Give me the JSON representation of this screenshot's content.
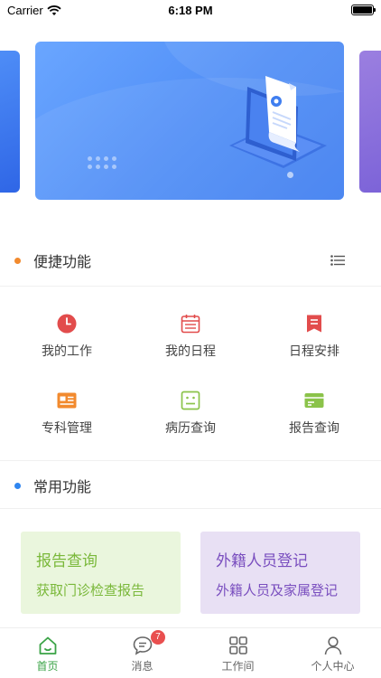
{
  "status_bar": {
    "carrier": "Carrier",
    "time": "6:18 PM"
  },
  "banner": {
    "active_index": 1,
    "icon": "laptop-document-illustration"
  },
  "quick_functions": {
    "title": "便捷功能",
    "accent_color": "#f28a2e",
    "items": [
      {
        "label": "我的工作",
        "icon": "clock-icon",
        "color": "#e24c4c"
      },
      {
        "label": "我的日程",
        "icon": "calendar-icon",
        "color": "#e24c4c"
      },
      {
        "label": "日程安排",
        "icon": "bookmark-list-icon",
        "color": "#e24c4c"
      },
      {
        "label": "专科管理",
        "icon": "id-card-icon",
        "color": "#f28a2e"
      },
      {
        "label": "病历查询",
        "icon": "record-icon",
        "color": "#8bc34a"
      },
      {
        "label": "报告查询",
        "icon": "report-card-icon",
        "color": "#8bc34a"
      }
    ]
  },
  "common_functions": {
    "title": "常用功能",
    "accent_color": "#2f86f0",
    "cards": [
      {
        "title": "报告查询",
        "subtitle": "获取门诊检查报告"
      },
      {
        "title": "外籍人员登记",
        "subtitle": "外籍人员及家属登记"
      }
    ]
  },
  "tab_bar": {
    "active_color": "#3aa346",
    "tabs": [
      {
        "label": "首页",
        "icon": "home-icon",
        "active": true
      },
      {
        "label": "消息",
        "icon": "message-icon",
        "badge": "7"
      },
      {
        "label": "工作间",
        "icon": "grid-icon"
      },
      {
        "label": "个人中心",
        "icon": "user-icon"
      }
    ]
  }
}
